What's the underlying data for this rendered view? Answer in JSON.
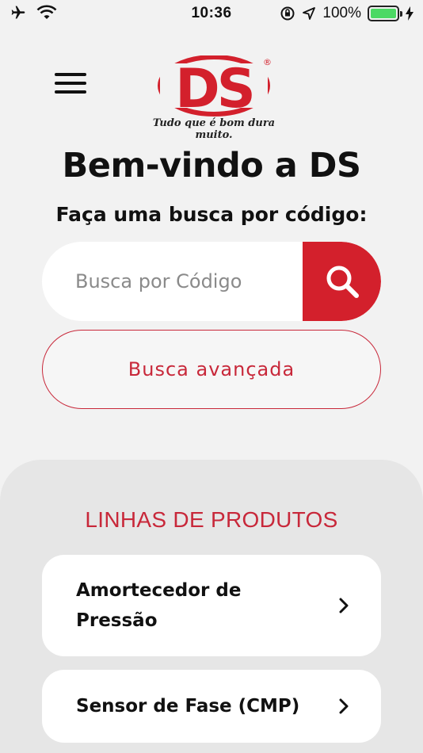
{
  "status_bar": {
    "time": "10:36",
    "battery_percent": "100%",
    "battery_level": 1.0,
    "icons": [
      "airplane-icon",
      "wifi-icon",
      "orientation-lock-icon",
      "location-icon",
      "battery-icon",
      "charging-icon"
    ]
  },
  "header": {
    "menu_icon": "hamburger-menu-icon",
    "logo_text": "DS",
    "logo_tagline": "Tudo que é bom dura muito.",
    "logo_mark": "®"
  },
  "main": {
    "title": "Bem-vindo a DS",
    "subtitle": "Faça uma busca por código:",
    "search": {
      "placeholder": "Busca por Código",
      "value": "",
      "button_icon": "search-icon"
    },
    "advanced_search_label": "Busca avançada"
  },
  "products": {
    "title": "LINHAS DE PRODUTOS",
    "items": [
      {
        "label": "Amortecedor de Pressão",
        "icon": "chevron-right-icon"
      },
      {
        "label": "Sensor de Fase (CMP)",
        "icon": "chevron-right-icon"
      }
    ]
  },
  "colors": {
    "brand_red": "#d3202c",
    "accent_red": "#c8283a",
    "background": "#f2f2f2",
    "panel": "#e6e6e6",
    "battery_green": "#4cd964"
  }
}
